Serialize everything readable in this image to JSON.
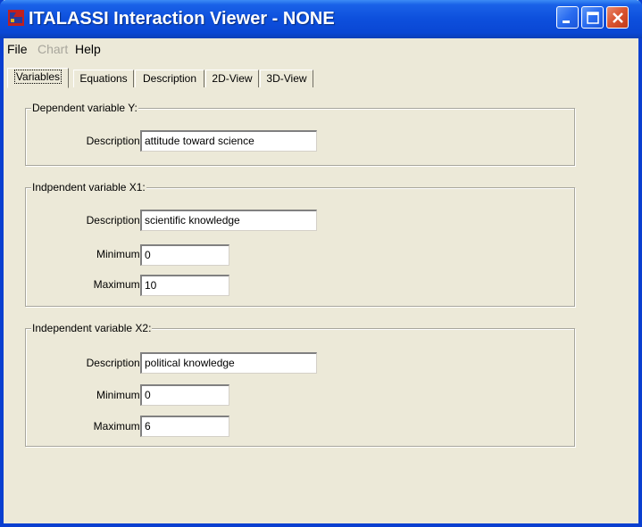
{
  "window": {
    "title": "ITALASSI Interaction Viewer - NONE"
  },
  "menu": {
    "file": "File",
    "chart": "Chart",
    "help": "Help"
  },
  "tabs": [
    {
      "label": "Variables",
      "active": true
    },
    {
      "label": "Equations",
      "active": false
    },
    {
      "label": "Description",
      "active": false
    },
    {
      "label": "2D-View",
      "active": false
    },
    {
      "label": "3D-View",
      "active": false
    }
  ],
  "groups": {
    "dependent_y": {
      "title": "Dependent variable Y:",
      "description_label": "Description:",
      "description_value": "attitude toward science"
    },
    "independent_x1": {
      "title": "Indpendent variable X1:",
      "description_label": "Description:",
      "description_value": "scientific knowledge",
      "minimum_label": "Minimum:",
      "minimum_value": "0",
      "maximum_label": "Maximum:",
      "maximum_value": "10"
    },
    "independent_x2": {
      "title": "Independent variable X2:",
      "description_label": "Description:",
      "description_value": "political knowledge",
      "minimum_label": "Minimum:",
      "minimum_value": "0",
      "maximum_label": "Maximum:",
      "maximum_value": "6"
    }
  },
  "colors": {
    "titlebar": "#0a47d4",
    "window_bg": "#ece9d8",
    "close_button": "#d9532f"
  },
  "icons": {
    "app": "italassi-app-icon",
    "minimize": "minimize-icon",
    "maximize": "maximize-icon",
    "close": "close-icon"
  }
}
